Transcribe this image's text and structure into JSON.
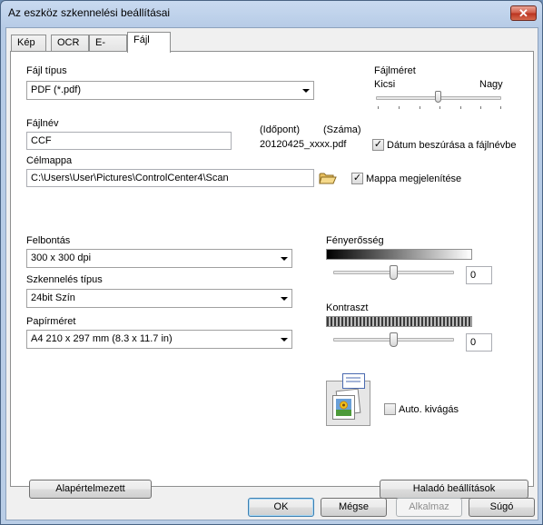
{
  "window": {
    "title": "Az eszköz szkennelési beállításai",
    "close_glyph": "✕"
  },
  "tabs": [
    {
      "label": "Kép"
    },
    {
      "label": "OCR"
    },
    {
      "label": "E-mail"
    },
    {
      "label": "Fájl"
    }
  ],
  "file_section": {
    "file_type_label": "Fájl típus",
    "file_type_value": "PDF (*.pdf)",
    "file_size_label": "Fájlméret",
    "file_size_small": "Kicsi",
    "file_size_large": "Nagy",
    "file_size_level_percent": 50,
    "file_name_label": "Fájlnév",
    "file_name_value": "CCF",
    "time_label": "(Időpont)",
    "number_label": "(Száma)",
    "file_name_preview": "20120425_xxxx.pdf",
    "insert_date_label": "Dátum beszúrása a fájlnévbe",
    "insert_date_checked": true,
    "dest_folder_label": "Célmappa",
    "dest_folder_value": "C:\\Users\\User\\Pictures\\ControlCenter4\\Scan",
    "show_folder_label": "Mappa megjelenítése",
    "show_folder_checked": true
  },
  "scan_section": {
    "resolution_label": "Felbontás",
    "resolution_value": "300 x 300 dpi",
    "scan_type_label": "Szkennelés típus",
    "scan_type_value": "24bit Szín",
    "paper_size_label": "Papírméret",
    "paper_size_value": "A4 210 x 297 mm (8.3 x 11.7 in)",
    "brightness_label": "Fényerősség",
    "brightness_value": "0",
    "contrast_label": "Kontraszt",
    "contrast_value": "0",
    "auto_crop_label": "Auto. kivágás",
    "auto_crop_checked": false
  },
  "buttons": {
    "defaults": "Alapértelmezett",
    "advanced": "Haladó beállítások",
    "ok": "OK",
    "cancel": "Mégse",
    "apply": "Alkalmaz",
    "help": "Súgó"
  },
  "colors": {
    "window_frame": "#b9cde6",
    "close_button": "#cf5a45",
    "default_button_border": "#3c7fb1"
  }
}
